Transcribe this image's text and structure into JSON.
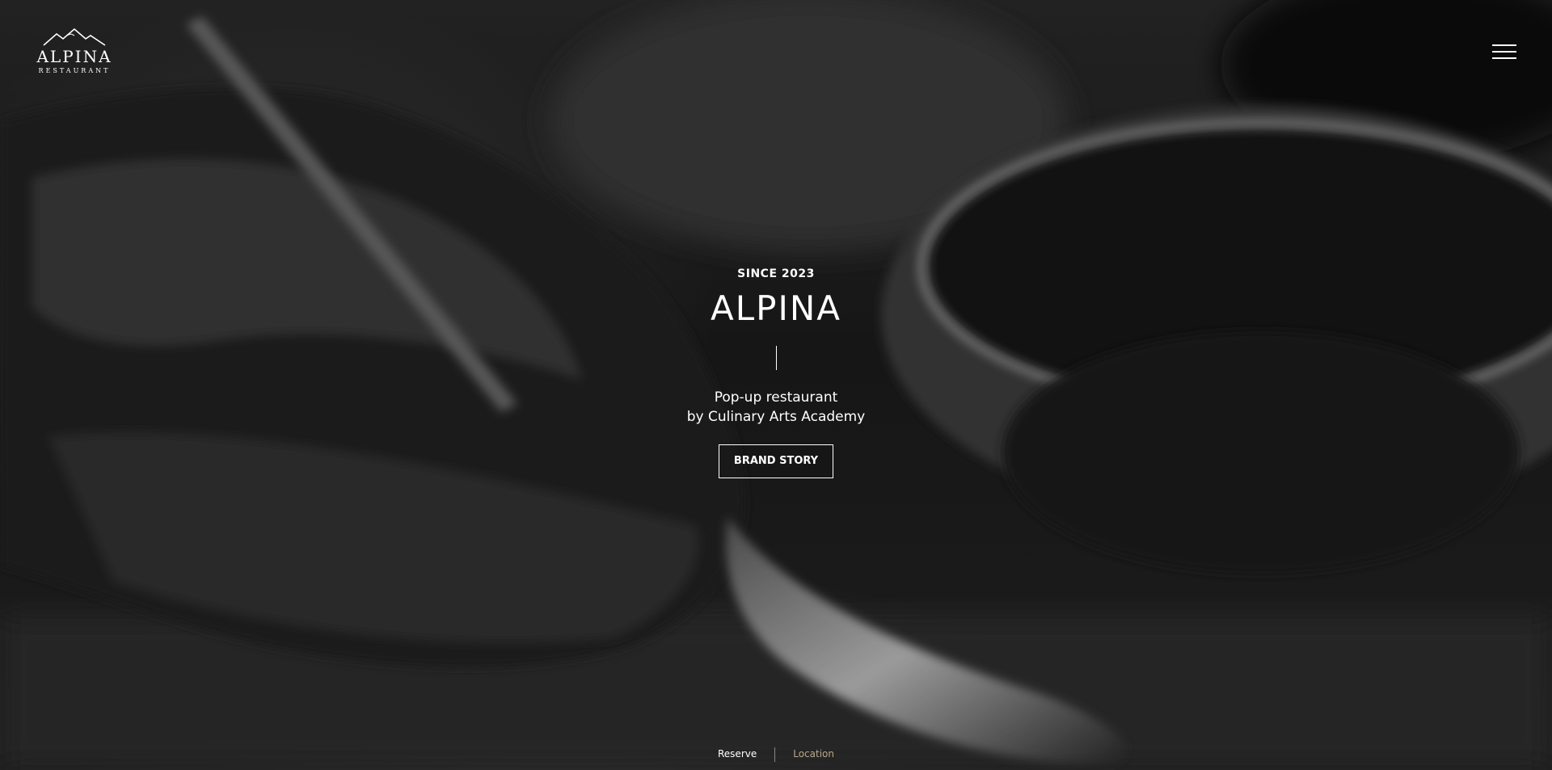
{
  "header": {
    "logo_name": "ALPINA",
    "logo_sub": "RESTAURANT",
    "menu_icon": "hamburger-menu-icon"
  },
  "hero": {
    "since": "SINCE 2023",
    "title": "ALPINA",
    "subtitle_line1": "Pop-up restaurant",
    "subtitle_line2": "by Culinary Arts Academy",
    "button_label": "BRAND STORY"
  },
  "footer_links": {
    "reserve": "Reserve",
    "location": "Location"
  },
  "colors": {
    "text": "#ffffff",
    "location_link": "#b9a88a",
    "background": "#1c1c1c"
  }
}
